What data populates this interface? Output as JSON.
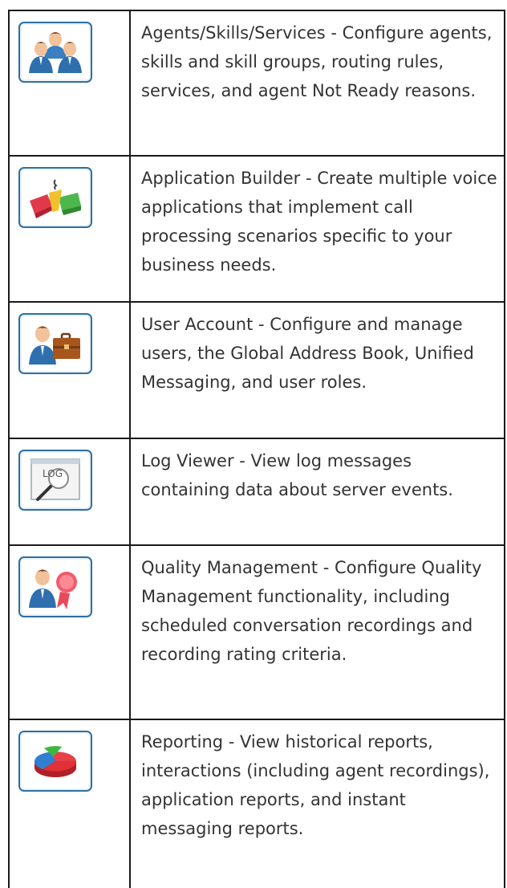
{
  "rows": [
    {
      "icon": "agents-icon",
      "text": "Agents/Skills/Services - Configure agents, skills and skill groups, routing rules, services, and agent Not Ready reasons."
    },
    {
      "icon": "application-builder-icon",
      "text": "Application Builder - Create multiple voice applications that implement call processing scenarios specific to your business needs."
    },
    {
      "icon": "user-account-icon",
      "text": "User Account - Configure and manage users, the Global Address Book, Unified Messaging, and user roles."
    },
    {
      "icon": "log-viewer-icon",
      "text": "Log Viewer - View log messages containing data about server events."
    },
    {
      "icon": "quality-management-icon",
      "text": "Quality Management - Configure Quality Management functionality, including scheduled conversation recordings and recording rating criteria."
    },
    {
      "icon": "reporting-icon",
      "text": "Reporting - View historical reports, interactions (including agent recordings), application reports, and instant messaging reports."
    }
  ],
  "icon_text": {
    "log_label": "LOG"
  },
  "colors": {
    "icon_border": "#2f6f9f",
    "table_border": "#1a1a1a",
    "text": "#333333"
  }
}
